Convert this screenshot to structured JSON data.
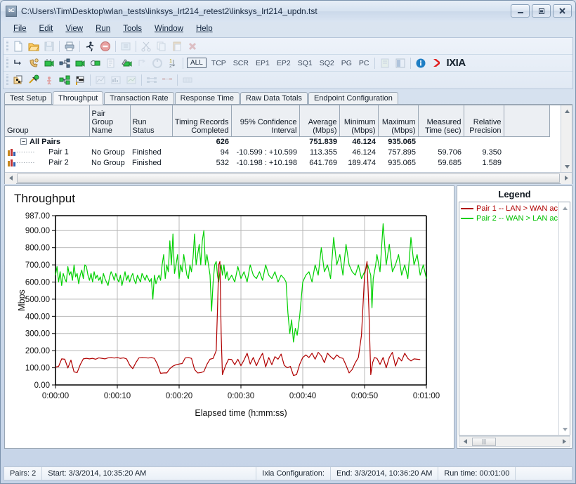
{
  "window": {
    "title": "C:\\Users\\Tim\\Desktop\\wlan_tests\\linksys_lrt214_retest2\\linksys_lrt214_updn.tst",
    "app_icon": "ixchariot-icon",
    "minimize_label": "Minimize",
    "maximize_label": "Maximize",
    "close_label": "Close"
  },
  "menu": {
    "items": [
      {
        "label": "File",
        "accel": "F"
      },
      {
        "label": "Edit",
        "accel": "E"
      },
      {
        "label": "View",
        "accel": "V"
      },
      {
        "label": "Run",
        "accel": "R"
      },
      {
        "label": "Tools",
        "accel": "T"
      },
      {
        "label": "Window",
        "accel": "W"
      },
      {
        "label": "Help",
        "accel": "H"
      }
    ]
  },
  "toolbar": {
    "row1": [
      {
        "name": "new-icon",
        "enabled": true
      },
      {
        "name": "open-folder-icon",
        "enabled": true
      },
      {
        "name": "save-icon",
        "enabled": false
      },
      {
        "name": "print-icon",
        "enabled": true
      },
      {
        "name": "run-icon",
        "enabled": true
      },
      {
        "name": "stop-icon",
        "enabled": true
      },
      {
        "name": "refresh-icon",
        "enabled": false
      },
      {
        "name": "cut-icon",
        "enabled": false
      },
      {
        "name": "copy-icon",
        "enabled": false
      },
      {
        "name": "paste-icon",
        "enabled": false
      },
      {
        "name": "delete-icon",
        "enabled": false
      }
    ],
    "row2": [
      {
        "name": "add-pair-icon",
        "enabled": true
      },
      {
        "name": "add-voip-pair-icon",
        "enabled": true
      },
      {
        "name": "add-video-pair-icon",
        "enabled": true
      },
      {
        "name": "add-multicast-group-icon",
        "enabled": true
      },
      {
        "name": "add-video-multicast-icon",
        "enabled": true
      },
      {
        "name": "add-hardware-pair-icon",
        "enabled": true
      },
      {
        "name": "edit-pair-icon",
        "enabled": false
      },
      {
        "name": "edit-video-pair-icon",
        "enabled": true
      },
      {
        "name": "copy-pair-icon",
        "enabled": false
      },
      {
        "name": "swap-endpoints-icon",
        "enabled": false
      },
      {
        "name": "reorder-pairs-icon",
        "enabled": true
      }
    ],
    "filters": [
      "ALL",
      "TCP",
      "SCR",
      "EP1",
      "EP2",
      "SQ1",
      "SQ2",
      "PG",
      "PC"
    ],
    "active_filter": "ALL",
    "row2_tail": [
      {
        "name": "report-icon",
        "enabled": false
      },
      {
        "name": "export-report-icon",
        "enabled": false
      },
      {
        "name": "info-icon",
        "enabled": true
      }
    ],
    "brand": "IXIA",
    "row3": [
      {
        "name": "run-test-icon",
        "enabled": true
      },
      {
        "name": "run-now-icon",
        "enabled": true
      },
      {
        "name": "run-again-icon",
        "enabled": true
      },
      {
        "name": "run-batch-icon",
        "enabled": true
      },
      {
        "name": "finish-icon",
        "enabled": true
      },
      {
        "name": "throughput-chart-icon",
        "enabled": false
      },
      {
        "name": "transaction-chart-icon",
        "enabled": false
      },
      {
        "name": "response-chart-icon",
        "enabled": false
      },
      {
        "name": "pair-detail-icon",
        "enabled": false
      },
      {
        "name": "endpoint-detail-icon",
        "enabled": false
      },
      {
        "name": "raw-data-icon",
        "enabled": false
      }
    ]
  },
  "tabs": {
    "items": [
      {
        "label": "Test Setup",
        "active": false
      },
      {
        "label": "Throughput",
        "active": true
      },
      {
        "label": "Transaction Rate",
        "active": false
      },
      {
        "label": "Response Time",
        "active": false
      },
      {
        "label": "Raw Data Totals",
        "active": false
      },
      {
        "label": "Endpoint Configuration",
        "active": false
      }
    ]
  },
  "grid": {
    "columns": [
      {
        "label": "Group",
        "align": "left"
      },
      {
        "label": "Pair Group\nName",
        "align": "left"
      },
      {
        "label": "Run Status",
        "align": "left"
      },
      {
        "label": "Timing Records\nCompleted",
        "align": "right"
      },
      {
        "label": "95% Confidence\nInterval",
        "align": "right"
      },
      {
        "label": "Average\n(Mbps)",
        "align": "right"
      },
      {
        "label": "Minimum\n(Mbps)",
        "align": "right"
      },
      {
        "label": "Maximum\n(Mbps)",
        "align": "right"
      },
      {
        "label": "Measured\nTime (sec)",
        "align": "right"
      },
      {
        "label": "Relative\nPrecision",
        "align": "right"
      },
      {
        "label": "",
        "align": "left"
      }
    ],
    "rows": [
      {
        "type": "group",
        "icon": "",
        "expander": "−",
        "group": "All Pairs",
        "pair_group_name": "",
        "run_status": "",
        "timing_records": "626",
        "confidence_interval": "",
        "average": "751.839",
        "minimum": "46.124",
        "maximum": "935.065",
        "measured_time": "",
        "relative_precision": ""
      },
      {
        "type": "pair",
        "icon": "bar-chart-icon",
        "group": "Pair 1",
        "pair_group_name": "No Group",
        "run_status": "Finished",
        "timing_records": "94",
        "confidence_interval": "-10.599 : +10.599",
        "average": "113.355",
        "minimum": "46.124",
        "maximum": "757.895",
        "measured_time": "59.706",
        "relative_precision": "9.350"
      },
      {
        "type": "pair",
        "icon": "bar-chart-icon",
        "group": "Pair 2",
        "pair_group_name": "No Group",
        "run_status": "Finished",
        "timing_records": "532",
        "confidence_interval": "-10.198 : +10.198",
        "average": "641.769",
        "minimum": "189.474",
        "maximum": "935.065",
        "measured_time": "59.685",
        "relative_precision": "1.589"
      }
    ]
  },
  "legend": {
    "title": "Legend",
    "items": [
      {
        "label": "Pair 1 -- LAN > WAN ac",
        "color": "#b00000"
      },
      {
        "label": "Pair 2 -- WAN > LAN ac",
        "color": "#00d000"
      }
    ]
  },
  "status": {
    "pairs": "Pairs: 2",
    "start": "Start: 3/3/2014, 10:35:20 AM",
    "configuration": "Ixia Configuration:",
    "end": "End: 3/3/2014, 10:36:20 AM",
    "runtime": "Run time: 00:01:00"
  },
  "chart_data": {
    "type": "line",
    "title": "Throughput",
    "xlabel": "Elapsed time (h:mm:ss)",
    "ylabel": "Mbps",
    "ylim": [
      0,
      987
    ],
    "yticks": [
      0,
      100,
      200,
      300,
      400,
      500,
      600,
      700,
      800,
      900,
      987
    ],
    "yticklabels": [
      "0.00",
      "100.00",
      "200.00",
      "300.00",
      "400.00",
      "500.00",
      "600.00",
      "700.00",
      "800.00",
      "900.00",
      "987.00"
    ],
    "xlim": [
      0,
      60
    ],
    "xticks": [
      0,
      10,
      20,
      30,
      40,
      50,
      60
    ],
    "xticklabels": [
      "0:00:00",
      "0:00:10",
      "0:00:20",
      "0:00:30",
      "0:00:40",
      "0:00:50",
      "0:01:00"
    ],
    "grid": true,
    "legend_position": "right-panel",
    "series": [
      {
        "name": "Pair 1 -- LAN > WAN ac",
        "color": "#b00000",
        "x": [
          0.0,
          0.5,
          1.0,
          1.5,
          2.0,
          2.5,
          3.0,
          3.5,
          4.0,
          4.5,
          5.0,
          5.5,
          6.0,
          6.5,
          7.0,
          7.5,
          8.0,
          8.5,
          9.0,
          9.5,
          10.0,
          10.5,
          11.0,
          11.5,
          12.0,
          12.5,
          13.0,
          13.5,
          14.0,
          14.5,
          15.0,
          15.5,
          16.0,
          16.5,
          17.0,
          17.5,
          18.0,
          18.5,
          19.0,
          19.5,
          20.0,
          20.5,
          21.0,
          21.5,
          22.0,
          22.5,
          23.0,
          23.5,
          24.0,
          24.5,
          25.0,
          25.5,
          26.0,
          26.2,
          26.4,
          26.6,
          26.8,
          27.0,
          27.5,
          28.0,
          28.5,
          29.0,
          29.5,
          30.0,
          30.5,
          31.0,
          31.5,
          32.0,
          32.5,
          33.0,
          33.5,
          34.0,
          34.5,
          35.0,
          35.5,
          36.0,
          36.5,
          37.0,
          37.5,
          38.0,
          38.5,
          39.0,
          39.5,
          40.0,
          40.5,
          41.0,
          41.5,
          42.0,
          42.5,
          43.0,
          43.5,
          44.0,
          44.5,
          45.0,
          45.5,
          46.0,
          46.5,
          47.0,
          47.5,
          48.0,
          48.5,
          49.0,
          49.5,
          50.0,
          50.4,
          50.7,
          51.0,
          51.3,
          51.6,
          52.0,
          52.5,
          53.0,
          53.5,
          54.0,
          54.5,
          55.0,
          55.5,
          56.0,
          56.5,
          57.0,
          57.5,
          58.0,
          58.5,
          59.0,
          59.5,
          60.0
        ],
        "y": [
          104,
          108,
          152,
          150,
          99,
          145,
          76,
          72,
          118,
          152,
          155,
          152,
          155,
          150,
          158,
          155,
          152,
          158,
          160,
          157,
          160,
          155,
          158,
          152,
          116,
          95,
          130,
          158,
          160,
          159,
          157,
          160,
          155,
          120,
          68,
          70,
          70,
          95,
          110,
          118,
          122,
          125,
          158,
          160,
          155,
          90,
          70,
          72,
          78,
          120,
          150,
          155,
          200,
          430,
          700,
          720,
          300,
          60,
          112,
          150,
          148,
          118,
          150,
          112,
          145,
          185,
          122,
          160,
          112,
          152,
          185,
          105,
          160,
          118,
          165,
          150,
          180,
          115,
          100,
          108,
          55,
          60,
          120,
          160,
          175,
          160,
          185,
          150,
          190,
          170,
          130,
          185,
          165,
          150,
          175,
          160,
          155,
          115,
          70,
          90,
          130,
          160,
          290,
          640,
          720,
          440,
          60,
          130,
          160,
          155,
          120,
          160,
          100,
          160,
          190,
          110,
          160,
          140,
          185,
          155,
          140,
          152,
          150,
          148
        ]
      },
      {
        "name": "Pair 2 -- WAN > LAN ac",
        "color": "#00d000",
        "x": [
          0.0,
          0.25,
          0.5,
          0.75,
          1.0,
          1.25,
          1.5,
          1.75,
          2.0,
          2.25,
          2.5,
          2.75,
          3.0,
          3.25,
          3.5,
          3.75,
          4.0,
          4.25,
          4.5,
          4.75,
          5.0,
          5.25,
          5.5,
          5.75,
          6.0,
          6.25,
          6.5,
          6.75,
          7.0,
          7.25,
          7.5,
          7.75,
          8.0,
          8.25,
          8.5,
          8.75,
          9.0,
          9.25,
          9.5,
          9.75,
          10.0,
          10.25,
          10.5,
          10.75,
          11.0,
          11.25,
          11.5,
          11.75,
          12.0,
          12.25,
          12.5,
          12.75,
          13.0,
          13.25,
          13.5,
          13.75,
          14.0,
          14.25,
          14.5,
          14.75,
          15.0,
          15.25,
          15.5,
          15.75,
          16.0,
          16.25,
          16.5,
          16.75,
          17.0,
          17.25,
          17.5,
          17.75,
          18.0,
          18.25,
          18.5,
          18.75,
          19.0,
          19.25,
          19.5,
          19.75,
          20.0,
          20.25,
          20.5,
          20.75,
          21.0,
          21.25,
          21.5,
          21.75,
          22.0,
          22.25,
          22.5,
          22.75,
          23.0,
          23.25,
          23.5,
          23.75,
          24.0,
          24.25,
          24.5,
          24.75,
          25.0,
          25.25,
          25.5,
          25.75,
          26.0,
          26.2,
          26.4,
          26.6,
          26.8,
          27.0,
          27.25,
          27.5,
          27.75,
          28.0,
          28.5,
          29.0,
          29.5,
          30.0,
          30.5,
          31.0,
          31.5,
          32.0,
          32.5,
          33.0,
          33.5,
          34.0,
          34.5,
          35.0,
          35.5,
          36.0,
          36.5,
          37.0,
          37.3,
          37.6,
          37.9,
          38.2,
          38.5,
          38.8,
          39.1,
          39.5,
          40.0,
          40.5,
          41.0,
          41.5,
          42.0,
          42.5,
          43.0,
          43.5,
          44.0,
          44.5,
          45.0,
          45.5,
          46.0,
          46.5,
          47.0,
          47.5,
          48.0,
          48.5,
          49.0,
          49.5,
          50.0,
          50.5,
          51.0,
          51.2,
          51.4,
          51.8,
          52.0,
          52.5,
          53.0,
          53.5,
          54.0,
          54.5,
          55.0,
          55.5,
          56.0,
          56.5,
          57.0,
          57.5,
          58.0,
          58.5,
          59.0,
          59.5,
          60.0
        ],
        "y": [
          640,
          690,
          600,
          660,
          580,
          650,
          620,
          600,
          690,
          640,
          660,
          610,
          700,
          630,
          650,
          590,
          640,
          670,
          620,
          700,
          690,
          640,
          610,
          650,
          600,
          660,
          620,
          640,
          610,
          630,
          590,
          650,
          620,
          600,
          580,
          630,
          660,
          640,
          610,
          650,
          620,
          600,
          640,
          580,
          620,
          660,
          610,
          640,
          600,
          630,
          650,
          610,
          590,
          640,
          620,
          600,
          650,
          630,
          610,
          640,
          620,
          600,
          620,
          500,
          640,
          590,
          620,
          640,
          610,
          700,
          760,
          620,
          700,
          660,
          840,
          700,
          880,
          650,
          700,
          760,
          620,
          700,
          660,
          760,
          700,
          640,
          620,
          700,
          660,
          740,
          880,
          700,
          760,
          820,
          700,
          840,
          900,
          700,
          760,
          700,
          640,
          430,
          600,
          700,
          720,
          640,
          600,
          660,
          700,
          640,
          700,
          620,
          660,
          610,
          640,
          600,
          690,
          620,
          660,
          600,
          700,
          640,
          620,
          660,
          610,
          700,
          640,
          620,
          660,
          600,
          640,
          620,
          600,
          420,
          300,
          380,
          250,
          330,
          290,
          400,
          600,
          640,
          660,
          600,
          700,
          640,
          800,
          660,
          700,
          620,
          860,
          700,
          760,
          640,
          820,
          700,
          660,
          640,
          700,
          620,
          660,
          700,
          640,
          450,
          620,
          700,
          760,
          660,
          940,
          700,
          820,
          660,
          700,
          760,
          640,
          700,
          620,
          860,
          700,
          760,
          640,
          700,
          620,
          660,
          580
        ]
      }
    ]
  }
}
